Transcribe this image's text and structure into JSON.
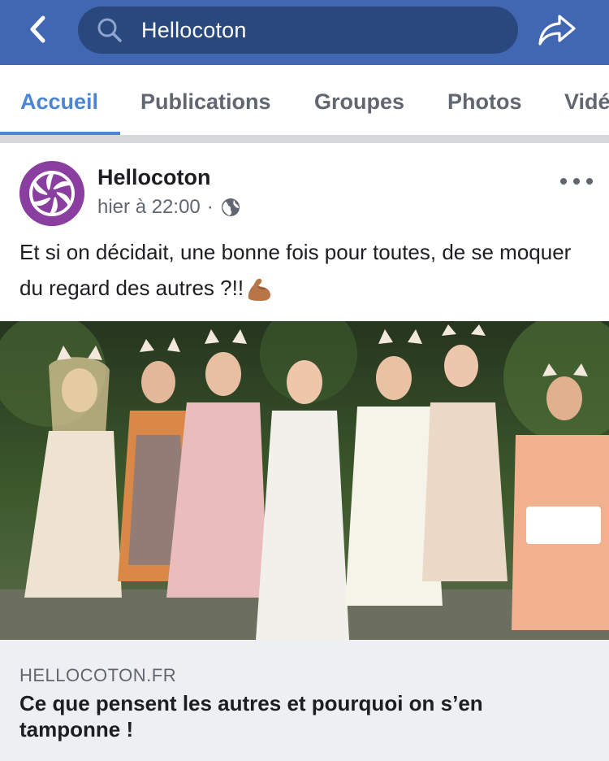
{
  "header": {
    "search_query": "Hellocoton",
    "icons": {
      "back": "chevron-left-icon",
      "search": "search-icon",
      "share": "share-arrow-icon"
    },
    "bar_color": "#4267b2"
  },
  "tabs": [
    {
      "label": "Accueil",
      "active": true
    },
    {
      "label": "Publications",
      "active": false
    },
    {
      "label": "Groupes",
      "active": false
    },
    {
      "label": "Photos",
      "active": false
    },
    {
      "label": "Vidé",
      "active": false
    }
  ],
  "post": {
    "author": "Hellocoton",
    "time": "hier à 22:00",
    "separator": "·",
    "privacy_icon": "globe-icon",
    "text": "Et si on décidait, une bonne fois pour toutes, de se moquer du regard des autres ?!!",
    "emoji": "flexed-biceps-icon"
  },
  "link_preview": {
    "domain": "HELLOCOTON.FR",
    "title": "Ce que pensent les autres et pourquoi on s’en tamponne !"
  },
  "colors": {
    "accent": "#4a86d4",
    "avatar": "#8a3fa0",
    "card_bg": "#edeff2"
  }
}
